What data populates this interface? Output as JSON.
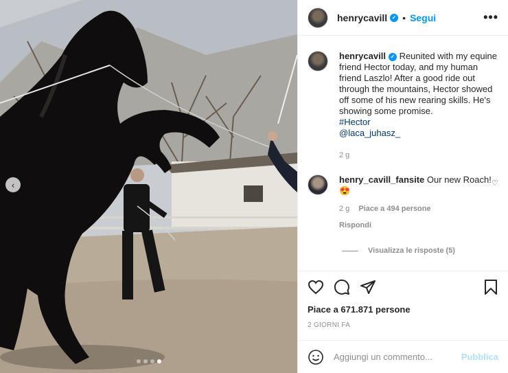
{
  "post": {
    "author": "henrycavill",
    "verified": true,
    "separator": "•",
    "follow_label": "Segui",
    "more_label": "•••",
    "caption": "Reunited with my equine friend Hector today, and my human friend Laszlo! After a good ride out through the mountains, Hector showed off some of his new rearing skills. He's showing some promise.",
    "hashtag": "#Hector",
    "mention": "@laca_juhasz_",
    "caption_age": "2 g"
  },
  "media": {
    "prev_icon": "‹",
    "slide_count": 4,
    "active_slide": 4
  },
  "comments": [
    {
      "username": "henry_cavill_fansite",
      "text": "Our new Roach! 😍",
      "age": "2 g",
      "likes": "Piace a 494 persone",
      "reply_label": "Rispondi",
      "view_replies": "Visualizza le risposte (5)"
    }
  ],
  "actions": {
    "likes_text": "Piace a 671.871 persone",
    "date": "2 GIORNI FA"
  },
  "add_comment": {
    "placeholder": "Aggiungi un commento...",
    "publish_label": "Pubblica"
  },
  "colors": {
    "accent": "#0095f6",
    "link": "#00376b",
    "muted": "#8e8e8e",
    "publish_disabled": "#b2dffc"
  }
}
